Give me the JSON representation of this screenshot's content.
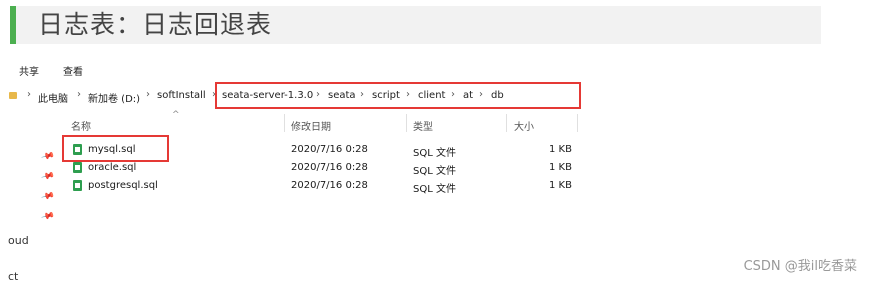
{
  "heading": {
    "text": "日志表：日志回退表"
  },
  "ribbon": {
    "tab_share": "共享",
    "tab_view": "查看"
  },
  "address": {
    "crumbs": [
      "此电脑",
      "新加卷 (D:)",
      "softInstall",
      "seata-server-1.3.0",
      "seata",
      "script",
      "client",
      "at",
      "db"
    ],
    "separator": "›"
  },
  "columns": {
    "name": "名称",
    "modified": "修改日期",
    "type": "类型",
    "size": "大小"
  },
  "files": [
    {
      "name": "mysql.sql",
      "modified": "2020/7/16 0:28",
      "type": "SQL 文件",
      "size": "1 KB"
    },
    {
      "name": "oracle.sql",
      "modified": "2020/7/16 0:28",
      "type": "SQL 文件",
      "size": "1 KB"
    },
    {
      "name": "postgresql.sql",
      "modified": "2020/7/16 0:28",
      "type": "SQL 文件",
      "size": "1 KB"
    }
  ],
  "nav_fragments": [
    "oud",
    "ct"
  ],
  "watermark": "CSDN @我il吃香菜",
  "colors": {
    "accent_green": "#4caf50",
    "highlight_red": "#e53935",
    "file_icon": "#2e9e4f"
  }
}
